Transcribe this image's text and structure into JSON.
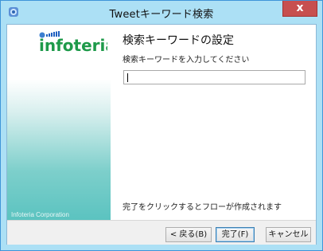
{
  "window": {
    "title": "Tweetキーワード検索",
    "close_label": "x"
  },
  "side_panel": {
    "logo_text": "infoteria",
    "footer_text": "Infoteria Corporation"
  },
  "main": {
    "heading": "検索キーワードの設定",
    "instruction": "検索キーワードを入力してください",
    "keyword_input": {
      "value": "",
      "placeholder": ""
    },
    "completion_note": "完了をクリックするとフローが作成されます"
  },
  "buttons": {
    "back": "< 戻る(B)",
    "finish": "完了(F)",
    "cancel": "キャンセル"
  },
  "colors": {
    "frame": "#ace0f5",
    "close_button": "#c74f4f",
    "brand_green": "#1e9a4a",
    "brand_blue": "#2060c0"
  },
  "icons": {
    "app": "app-icon",
    "logo_mark": "infoteria-logo"
  }
}
